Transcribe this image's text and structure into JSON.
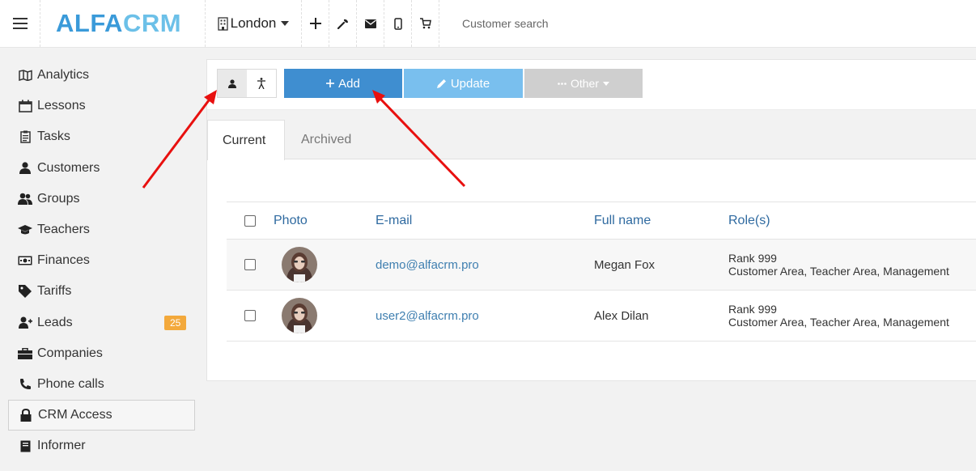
{
  "header": {
    "logo_part1": "ALFA",
    "logo_part2": "CRM",
    "branch": "London",
    "search_placeholder": "Customer search",
    "icons": [
      "plus-icon",
      "wrench-icon",
      "envelope-icon",
      "mobile-icon",
      "cart-icon"
    ]
  },
  "sidebar": {
    "items": [
      {
        "label": "Analytics",
        "icon": "map-icon"
      },
      {
        "label": "Lessons",
        "icon": "calendar-icon"
      },
      {
        "label": "Tasks",
        "icon": "clipboard-icon"
      },
      {
        "label": "Customers",
        "icon": "user-icon"
      },
      {
        "label": "Groups",
        "icon": "users-icon"
      },
      {
        "label": "Teachers",
        "icon": "graduation-cap-icon"
      },
      {
        "label": "Finances",
        "icon": "money-icon"
      },
      {
        "label": "Tariffs",
        "icon": "tag-icon"
      },
      {
        "label": "Leads",
        "icon": "user-plus-icon",
        "badge": "25"
      },
      {
        "label": "Companies",
        "icon": "briefcase-icon"
      },
      {
        "label": "Phone calls",
        "icon": "phone-icon"
      },
      {
        "label": "CRM Access",
        "icon": "lock-icon",
        "active": true
      },
      {
        "label": "Informer",
        "icon": "book-icon"
      }
    ]
  },
  "toolbar": {
    "add_label": "Add",
    "update_label": "Update",
    "other_label": "Other"
  },
  "tabs": [
    {
      "label": "Current",
      "active": true
    },
    {
      "label": "Archived",
      "active": false
    }
  ],
  "table": {
    "columns": [
      "Photo",
      "E-mail",
      "Full name",
      "Role(s)"
    ],
    "rows": [
      {
        "email": "demo@alfacrm.pro",
        "name": "Megan Fox",
        "rank": "Rank 999",
        "areas": "Customer Area, Teacher Area, Management"
      },
      {
        "email": "user2@alfacrm.pro",
        "name": "Alex Dilan",
        "rank": "Rank 999",
        "areas": "Customer Area, Teacher Area, Management"
      }
    ]
  },
  "colors": {
    "logo_primary": "#3a9ad9",
    "logo_secondary": "#6cc0e8",
    "add_button": "#3f8ed0",
    "update_button": "#79bfee",
    "other_button": "#cfcfcf",
    "badge": "#f3a93c",
    "annotation_arrow": "#e8100f"
  }
}
